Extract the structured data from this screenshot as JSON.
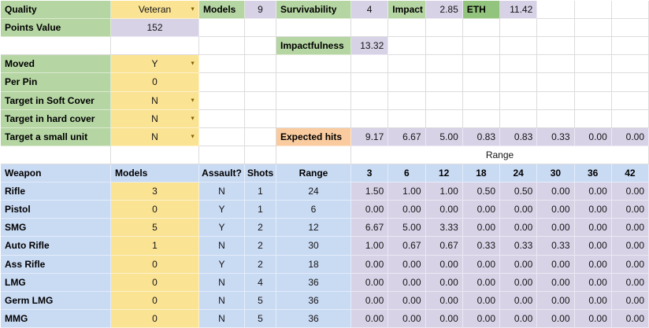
{
  "colors": {
    "label_green": "#b5d5a3",
    "dark_green": "#93c47d",
    "input_yellow": "#fbe394",
    "value_purple": "#d8d2e7",
    "expected_orange": "#f9cb9f",
    "table_blue": "#c9daf3",
    "gridline": "#dcdcdc",
    "dropdown_arrow": "#7f6000"
  },
  "icons": {
    "dropdown_arrow": "▼"
  },
  "top": {
    "quality_label": "Quality",
    "quality_value": "Veteran",
    "models_label": "Models",
    "models_value": "9",
    "survivability_label": "Survivability",
    "survivability_value": "4",
    "impact_label": "Impact",
    "impact_value": "2.85",
    "eth_label": "ETH",
    "eth_value": "11.42",
    "points_label": "Points Value",
    "points_value": "152",
    "impactfulness_label": "Impactfulness",
    "impactfulness_value": "13.32"
  },
  "controls": {
    "moved": {
      "label": "Moved",
      "value": "Y",
      "dropdown": true
    },
    "per_pin": {
      "label": "Per Pin",
      "value": "0",
      "dropdown": false
    },
    "soft_cover": {
      "label": "Target in Soft Cover",
      "value": "N",
      "dropdown": true
    },
    "hard_cover": {
      "label": "Target in hard cover",
      "value": "N",
      "dropdown": true
    },
    "small_unit": {
      "label": "Target a small unit",
      "value": "N",
      "dropdown": true
    }
  },
  "expected_hits": {
    "label": "Expected hits",
    "values": [
      "9.17",
      "6.67",
      "5.00",
      "0.83",
      "0.83",
      "0.33",
      "0.00",
      "0.00"
    ]
  },
  "range_band_label": "Range",
  "table": {
    "headers": {
      "weapon": "Weapon",
      "models": "Models",
      "assault": "Assault?",
      "shots": "Shots",
      "range": "Range"
    },
    "range_columns": [
      "3",
      "6",
      "12",
      "18",
      "24",
      "30",
      "36",
      "42"
    ],
    "weapons": [
      {
        "name": "Rifle",
        "models": "3",
        "assault": "N",
        "shots": "1",
        "range": "24",
        "hits": [
          "1.50",
          "1.00",
          "1.00",
          "0.50",
          "0.50",
          "0.00",
          "0.00",
          "0.00"
        ]
      },
      {
        "name": "Pistol",
        "models": "0",
        "assault": "Y",
        "shots": "1",
        "range": "6",
        "hits": [
          "0.00",
          "0.00",
          "0.00",
          "0.00",
          "0.00",
          "0.00",
          "0.00",
          "0.00"
        ]
      },
      {
        "name": "SMG",
        "models": "5",
        "assault": "Y",
        "shots": "2",
        "range": "12",
        "hits": [
          "6.67",
          "5.00",
          "3.33",
          "0.00",
          "0.00",
          "0.00",
          "0.00",
          "0.00"
        ]
      },
      {
        "name": "Auto Rifle",
        "models": "1",
        "assault": "N",
        "shots": "2",
        "range": "30",
        "hits": [
          "1.00",
          "0.67",
          "0.67",
          "0.33",
          "0.33",
          "0.33",
          "0.00",
          "0.00"
        ]
      },
      {
        "name": "Ass Rifle",
        "models": "0",
        "assault": "Y",
        "shots": "2",
        "range": "18",
        "hits": [
          "0.00",
          "0.00",
          "0.00",
          "0.00",
          "0.00",
          "0.00",
          "0.00",
          "0.00"
        ]
      },
      {
        "name": "LMG",
        "models": "0",
        "assault": "N",
        "shots": "4",
        "range": "36",
        "hits": [
          "0.00",
          "0.00",
          "0.00",
          "0.00",
          "0.00",
          "0.00",
          "0.00",
          "0.00"
        ]
      },
      {
        "name": "Germ LMG",
        "models": "0",
        "assault": "N",
        "shots": "5",
        "range": "36",
        "hits": [
          "0.00",
          "0.00",
          "0.00",
          "0.00",
          "0.00",
          "0.00",
          "0.00",
          "0.00"
        ]
      },
      {
        "name": "MMG",
        "models": "0",
        "assault": "N",
        "shots": "5",
        "range": "36",
        "hits": [
          "0.00",
          "0.00",
          "0.00",
          "0.00",
          "0.00",
          "0.00",
          "0.00",
          "0.00"
        ]
      }
    ]
  }
}
